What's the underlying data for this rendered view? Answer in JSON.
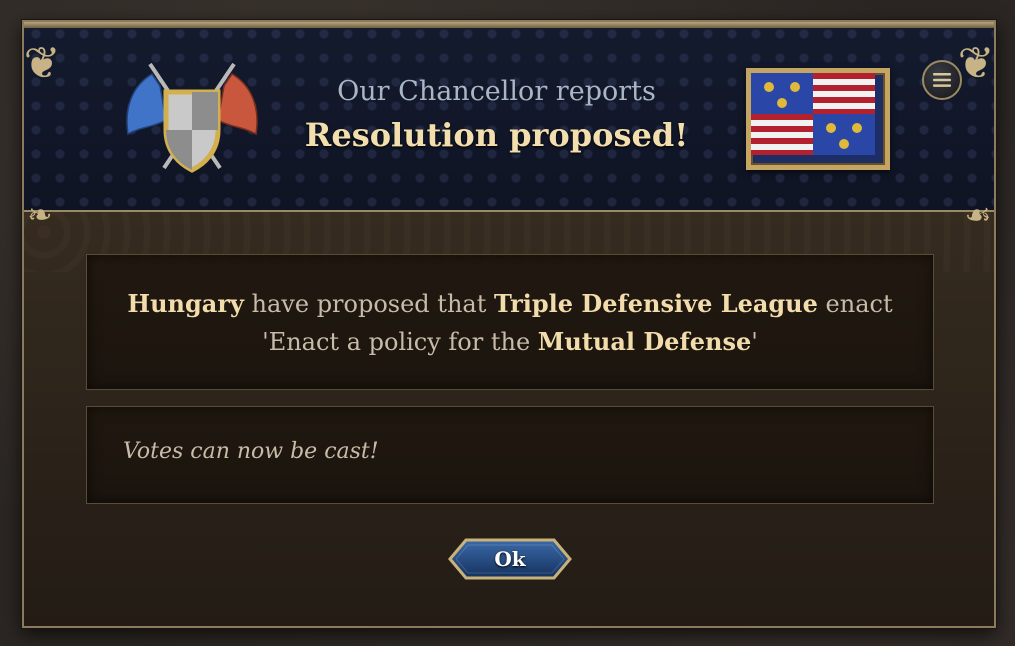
{
  "header": {
    "subtitle": "Our Chancellor reports",
    "title": "Resolution proposed!"
  },
  "message": {
    "part1": "Hungary",
    "part2": " have proposed that ",
    "part3": "Triple Defensive League",
    "part4": " enact 'Enact a policy for the ",
    "part5": "Mutual Defense",
    "part6": "'"
  },
  "votes": {
    "text": "Votes can now be cast!"
  },
  "buttons": {
    "ok_label": "Ok"
  },
  "colors": {
    "highlight": "#f3dcab",
    "body_text": "#c8bca9",
    "header_bg": "#141b2e",
    "gold_trim": "#c4a563"
  },
  "icons": {
    "emblem": "shield-with-flags-icon",
    "flag": "coat-of-arms-flag",
    "menu": "menu-icon"
  }
}
